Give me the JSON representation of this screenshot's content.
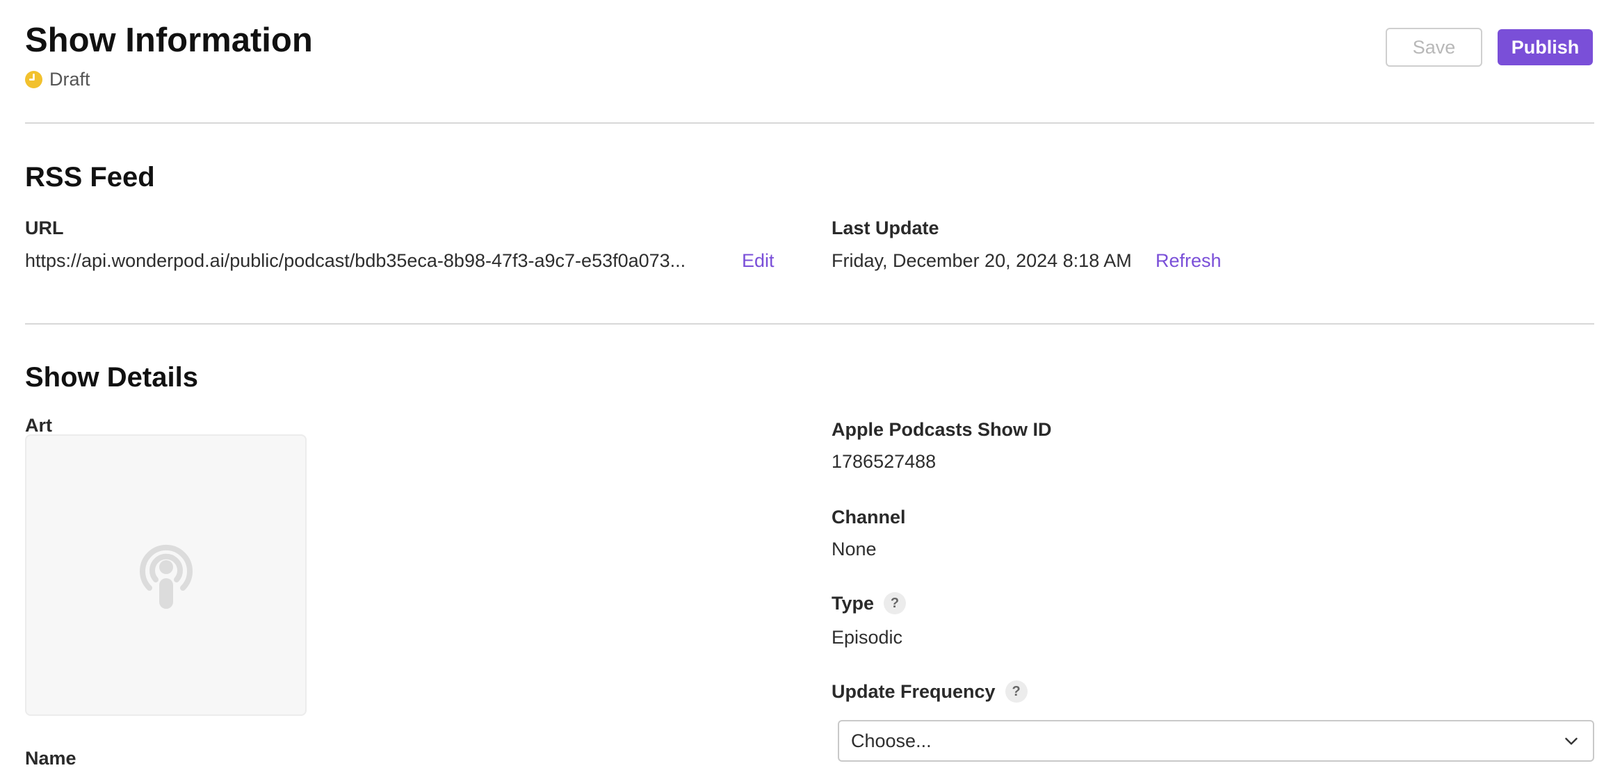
{
  "header": {
    "title": "Show Information",
    "status": "Draft",
    "status_color": "#f2c12e",
    "save_label": "Save",
    "publish_label": "Publish"
  },
  "rss": {
    "title": "RSS Feed",
    "url_label": "URL",
    "url_value": "https://api.wonderpod.ai/public/podcast/bdb35eca-8b98-47f3-a9c7-e53f0a073...",
    "edit_label": "Edit",
    "last_update_label": "Last Update",
    "last_update_value": "Friday, December 20, 2024 8:18 AM",
    "refresh_label": "Refresh"
  },
  "details": {
    "title": "Show Details",
    "art_label": "Art",
    "art_placeholder_icon": "podcast-icon",
    "name_label": "Name",
    "apple_id_label": "Apple Podcasts Show ID",
    "apple_id_value": "1786527488",
    "channel_label": "Channel",
    "channel_value": "None",
    "type_label": "Type",
    "type_value": "Episodic",
    "help_glyph": "?",
    "update_frequency_label": "Update Frequency",
    "update_frequency_value": "Choose..."
  },
  "colors": {
    "accent": "#7a4fd8",
    "divider": "#d8d8d8"
  }
}
